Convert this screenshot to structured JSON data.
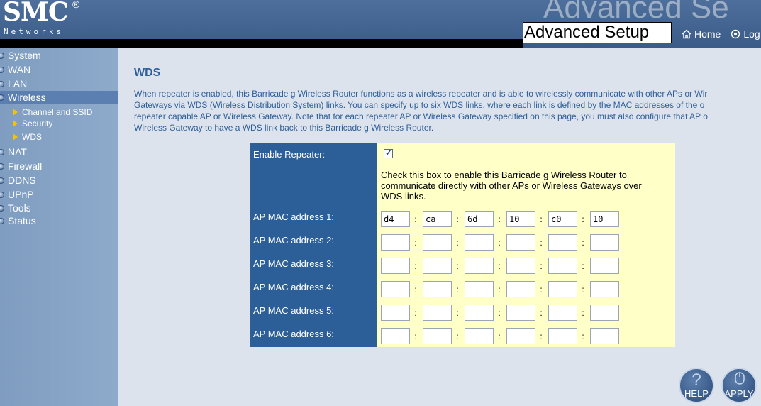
{
  "brand": {
    "name": "SMC",
    "registered": "®",
    "tagline": "Networks"
  },
  "header": {
    "ghost_title": "Advanced Se",
    "page_heading": "Advanced Setup",
    "nav": {
      "home": "Home",
      "logout": "Log"
    }
  },
  "sidebar": {
    "items": [
      "System",
      "WAN",
      "LAN",
      "Wireless",
      "NAT",
      "Firewall",
      "DDNS",
      "UPnP",
      "Tools",
      "Status"
    ],
    "active": "Wireless",
    "wireless_sub": [
      "Channel and SSID",
      "Security",
      "WDS"
    ]
  },
  "main": {
    "title": "WDS",
    "description": "When repeater is enabled, this Barricade g Wireless Router functions as a wireless repeater and is able to wirelessly communicate with other APs or Wir\nGateways via WDS (Wireless Distribution System) links. You can specify up to six WDS links, where each link is defined by the MAC addresses of the o\nrepeater capable AP or Wireless Gateway. Note that for each repeater AP or Wireless Gateway specified on this page, you must also configure that AP o\nWireless Gateway to have a WDS link back to this Barricade g Wireless Router."
  },
  "form": {
    "enable_label": "Enable Repeater:",
    "enable_checked": true,
    "enable_help": "Check this box to enable this Barricade g Wireless Router to\ncommunicate directly with other APs or Wireless Gateways over\nWDS links.",
    "separator": ":",
    "mac_rows": [
      {
        "label": "AP MAC address 1:",
        "octets": [
          "d4",
          "ca",
          "6d",
          "10",
          "c0",
          "10"
        ]
      },
      {
        "label": "AP MAC address 2:",
        "octets": [
          "",
          "",
          "",
          "",
          "",
          ""
        ]
      },
      {
        "label": "AP MAC address 3:",
        "octets": [
          "",
          "",
          "",
          "",
          "",
          ""
        ]
      },
      {
        "label": "AP MAC address 4:",
        "octets": [
          "",
          "",
          "",
          "",
          "",
          ""
        ]
      },
      {
        "label": "AP MAC address 5:",
        "octets": [
          "",
          "",
          "",
          "",
          "",
          ""
        ]
      },
      {
        "label": "AP MAC address 6:",
        "octets": [
          "",
          "",
          "",
          "",
          "",
          ""
        ]
      }
    ]
  },
  "buttons": {
    "help": "HELP",
    "apply": "APPLY"
  },
  "colors": {
    "header_bg": "#3a5b88",
    "sidebar_bg": "#8eaacb",
    "content_bg": "#dde3ec",
    "form_label_bg": "#2c5f97",
    "form_field_bg": "#ffffc8",
    "title_text": "#2d5f9a",
    "sub_nav_marker": "#f5c400"
  },
  "icons": {
    "home": "home-icon",
    "logout": "power-icon",
    "help": "question-icon",
    "apply": "mouse-icon"
  }
}
